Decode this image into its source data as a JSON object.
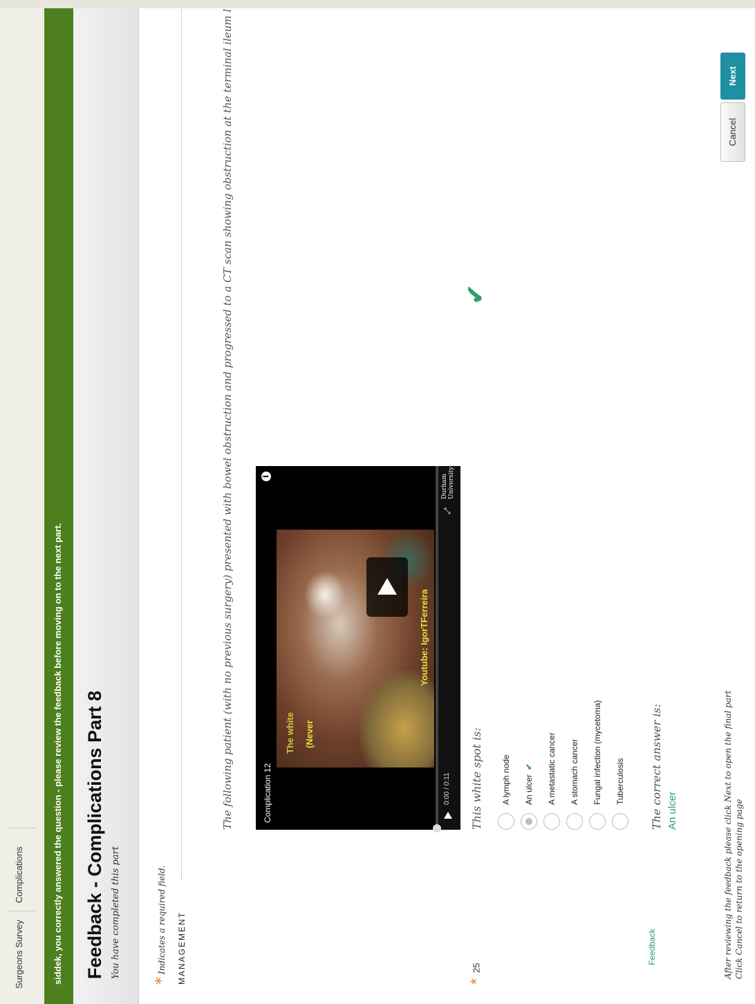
{
  "breadcrumb": {
    "items": [
      "Surgeons Survey",
      "Complications"
    ]
  },
  "banner": {
    "text": "siddek, you correctly answered the question - please review the feedback before moving on to the next part."
  },
  "header": {
    "title": "Feedback - Complications Part 8",
    "subtitle": "You have completed this part"
  },
  "required_note": "Indicates a required field.",
  "section": {
    "title": "MANAGEMENT"
  },
  "question": {
    "number": "25",
    "intro": "The following patient (with no previous surgery) presented with bowel obstruction and progressed to a CT scan showing obstruction at the terminal ileum level",
    "prompt": "This white spot is:",
    "options": [
      {
        "label": "A lymph node",
        "selected": false
      },
      {
        "label": "An ulcer",
        "selected": true,
        "correct": true
      },
      {
        "label": "A metastatic cancer",
        "selected": false
      },
      {
        "label": "A stomach cancer",
        "selected": false
      },
      {
        "label": "Fungal infection (mycetoma)",
        "selected": false
      },
      {
        "label": "Tuberculosis",
        "selected": false
      }
    ]
  },
  "video": {
    "title": "Complication 12",
    "overlay_line1": "The white ",
    "overlay_line2": "(Never ",
    "overlay_line3": "Youtube: IgorTFerreira",
    "time": "0:00 / 0:11",
    "logo": "Durham University"
  },
  "feedback": {
    "label": "Feedback",
    "correct_label": "The correct answer is:",
    "correct_value": "An ulcer",
    "note_line1": "After reviewing the feedback please click Next to open the final part",
    "note_line2": "Click Cancel to return to the opening page"
  },
  "buttons": {
    "cancel": "Cancel",
    "next": "Next"
  },
  "colors": {
    "banner": "#4d7f1e",
    "accent": "#2e9e6e",
    "next_button": "#1f8fa3",
    "required_star": "#ef7f21"
  }
}
